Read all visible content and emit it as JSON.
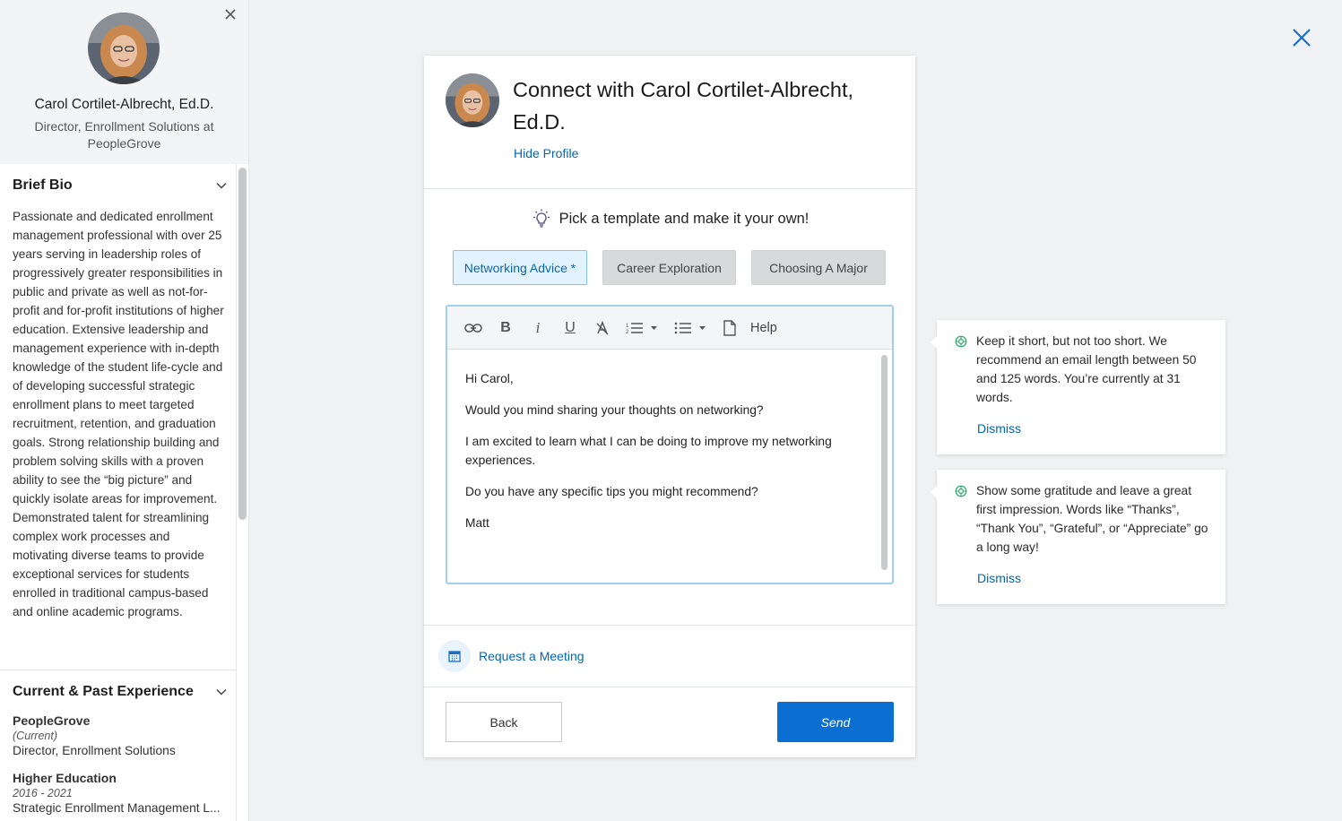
{
  "profile": {
    "name": "Carol Cortilet-Albrecht, Ed.D.",
    "title": "Director, Enrollment Solutions at PeopleGrove",
    "bio_heading": "Brief Bio",
    "bio": "Passionate and dedicated enrollment management professional with over 25 years serving in leadership roles of progressively greater responsibilities in public and private as well as not-for-profit and for-profit institutions of higher education. Extensive leadership and management experience with in-depth knowledge of the student life-cycle and of developing successful strategic enrollment plans to meet targeted recruitment, retention, and graduation goals. Strong relationship building and problem solving skills with a proven ability to see the “big picture” and quickly isolate areas for improvement. Demonstrated talent for streamlining complex work processes and motivating diverse teams to provide exceptional services for students enrolled in traditional campus-based and online academic programs.",
    "experience_heading": "Current & Past Experience",
    "experience": [
      {
        "company": "PeopleGrove",
        "when": "(Current)",
        "role": "Director, Enrollment Solutions"
      },
      {
        "company": "Higher Education",
        "when": "2016 - 2021",
        "role": "Strategic Enrollment Management L..."
      }
    ]
  },
  "modal": {
    "title": "Connect with Carol Cortilet-Albrecht, Ed.D.",
    "hide_profile": "Hide Profile",
    "pick_template": "Pick a template and make it your own!",
    "templates": [
      "Networking Advice *",
      "Career Exploration",
      "Choosing A Major"
    ],
    "toolbar": {
      "help": "Help"
    },
    "message": [
      "Hi Carol,",
      "Would you mind sharing your thoughts on networking?",
      "I am excited to learn what I can be doing to improve my networking experiences.",
      "Do you have any specific tips you might recommend?",
      "Matt"
    ],
    "request_meeting": "Request a Meeting",
    "back": "Back",
    "send": "Send"
  },
  "tips": [
    {
      "text": "Keep it short, but not too short. We recommend an email length between 50 and 125 words. You’re currently at 31 words.",
      "dismiss": "Dismiss"
    },
    {
      "text": "Show some gratitude and leave a great first impression. Words like “Thanks”, “Thank You”, “Grateful”, or “Appreciate” go a long way!",
      "dismiss": "Dismiss"
    }
  ],
  "colors": {
    "accent": "#0a6fd1",
    "link": "#0066b8",
    "tip_icon": "#2aa66a"
  }
}
